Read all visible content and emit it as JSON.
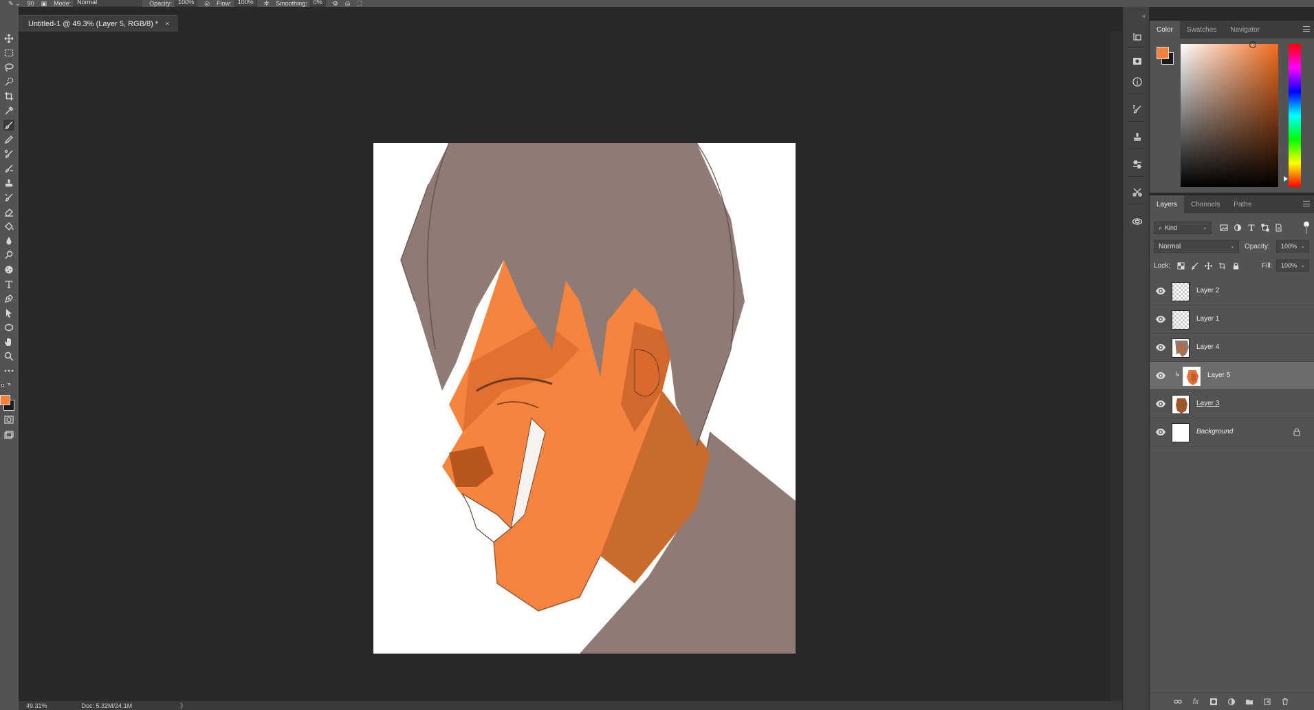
{
  "options_bar": {
    "brush_size": "90",
    "mode_label": "Mode:",
    "mode_value": "Normal",
    "opacity_label": "Opacity:",
    "opacity_value": "100%",
    "flow_label": "Flow:",
    "flow_value": "100%",
    "smoothing_label": "Smoothing:",
    "smoothing_value": "0%"
  },
  "document": {
    "tab_title": "Untitled-1 @ 49.3% (Layer 5, RGB/8) *",
    "close_glyph": "×"
  },
  "status_bar": {
    "zoom": "49.31%",
    "doc_info": "Doc: 5.32M/24.1M",
    "arrow": "〉"
  },
  "color_panel": {
    "tabs": [
      "Color",
      "Swatches",
      "Navigator"
    ],
    "foreground": "#f5813c",
    "background": "#1a1a1a"
  },
  "layers_panel": {
    "tabs": [
      "Layers",
      "Channels",
      "Paths"
    ],
    "kind_label": "Kind",
    "blend_mode": "Normal",
    "opacity_label": "Opacity:",
    "opacity_value": "100%",
    "lock_label": "Lock:",
    "fill_label": "Fill:",
    "fill_value": "100%",
    "layers": [
      {
        "name": "Layer 2",
        "thumb": "transparent",
        "visible": true
      },
      {
        "name": "Layer 1",
        "thumb": "transparent",
        "visible": true
      },
      {
        "name": "Layer 4",
        "thumb": "art",
        "visible": true
      },
      {
        "name": "Layer 5",
        "thumb": "art",
        "visible": true,
        "selected": true,
        "clipped": true
      },
      {
        "name": "Layer 3",
        "thumb": "art",
        "visible": true
      },
      {
        "name": "Background",
        "thumb": "white",
        "visible": true,
        "locked": true
      }
    ]
  },
  "colors": {
    "skin": "#f5843e",
    "skin_shadow": "#c45a22",
    "hair": "#8f7b74",
    "ui_panel": "#535353",
    "ui_dark": "#282828"
  }
}
